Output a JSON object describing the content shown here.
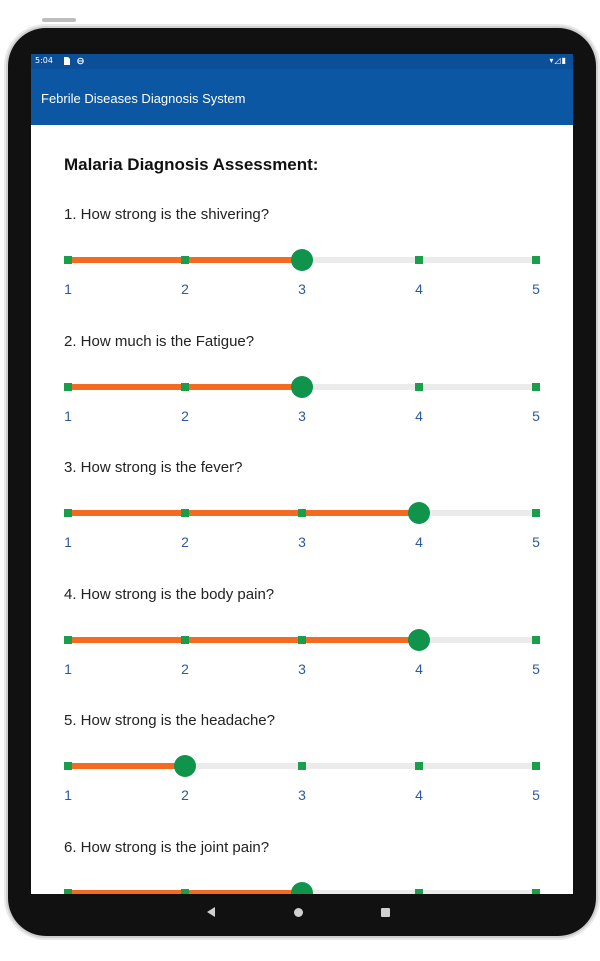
{
  "status_bar": {
    "time": "5:04",
    "right_icons": "▾◿▮"
  },
  "app_bar": {
    "title": "Febrile Diseases Diagnosis System"
  },
  "page": {
    "title": "Malaria Diagnosis Assessment:"
  },
  "scale_labels": [
    "1",
    "2",
    "3",
    "4",
    "5"
  ],
  "questions": [
    {
      "text": "1. How strong is the shivering?",
      "value": 3
    },
    {
      "text": "2. How much is the Fatigue?",
      "value": 3
    },
    {
      "text": "3. How strong is the fever?",
      "value": 4
    },
    {
      "text": "4. How strong is the body pain?",
      "value": 4
    },
    {
      "text": "5. How strong is the headache?",
      "value": 2
    },
    {
      "text": "6. How strong is the joint pain?",
      "value": 3
    }
  ],
  "colors": {
    "app_bar": "#0b57a3",
    "status_bar": "#0c4f99",
    "track_fill": "#f26b21",
    "track_empty": "#ebebeb",
    "thumb": "#10934a",
    "tick": "#1a9e4b",
    "tick_label": "#2c5aa0"
  },
  "icons": [
    "sim-card-icon",
    "data-saver-icon",
    "wifi-icon",
    "signal-icon",
    "battery-icon",
    "nav-back-icon",
    "nav-home-icon",
    "nav-recents-icon"
  ]
}
